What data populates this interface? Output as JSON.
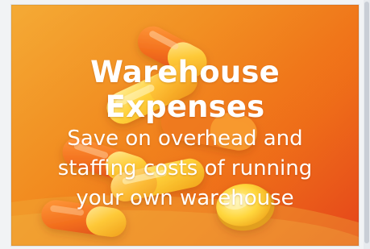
{
  "card": {
    "title": "Warehouse Expenses",
    "subtitle": "Save on overhead and staffing costs of running your own warehouse"
  },
  "colors": {
    "background": "#f1f3f5",
    "gradient_start": "#f2a22c",
    "gradient_end": "#e6431a",
    "capsule_orange": "#f26a1b",
    "capsule_yellow": "#ffc52b",
    "text": "#ffffff"
  },
  "icons": {
    "illustration": "capsule-pills-image"
  }
}
